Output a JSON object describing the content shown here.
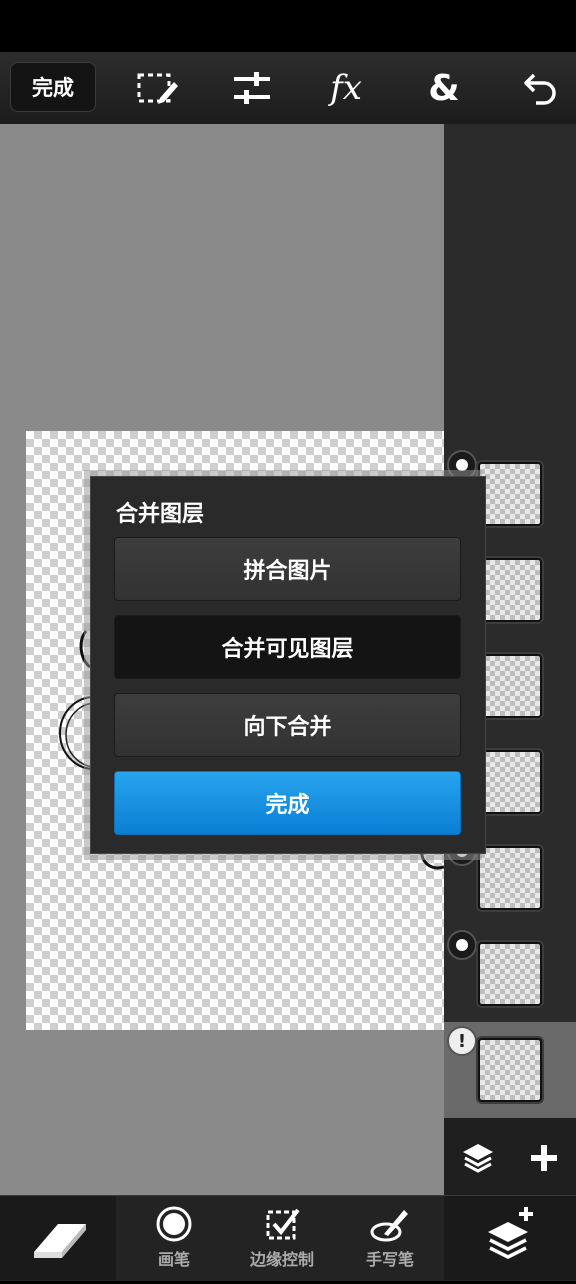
{
  "toolbar": {
    "done_label": "完成",
    "fx_label": "fx",
    "ampersand_label": "&"
  },
  "dialog": {
    "title": "合并图层",
    "flatten_label": "拼合图片",
    "merge_visible_label": "合并可见图层",
    "merge_down_label": "向下合并",
    "done_label": "完成"
  },
  "layers": {
    "count": 7,
    "selected_index": 6,
    "selected_badge": "!"
  },
  "bottom_tools": {
    "brush_label": "画笔",
    "edge_control_label": "边缘控制",
    "handwriting_label": "手写笔"
  },
  "icons": [
    "selection-pen-icon",
    "adjustments-icon",
    "fx-icon",
    "blend-icon",
    "undo-icon",
    "eraser-icon",
    "brush-icon",
    "edge-control-icon",
    "stylus-icon",
    "layers-icon",
    "add-icon",
    "add-layer-icon"
  ],
  "colors": {
    "accent_blue": "#1a93e3",
    "panel": "#2b2b2b",
    "workspace": "#8a8a8a"
  }
}
